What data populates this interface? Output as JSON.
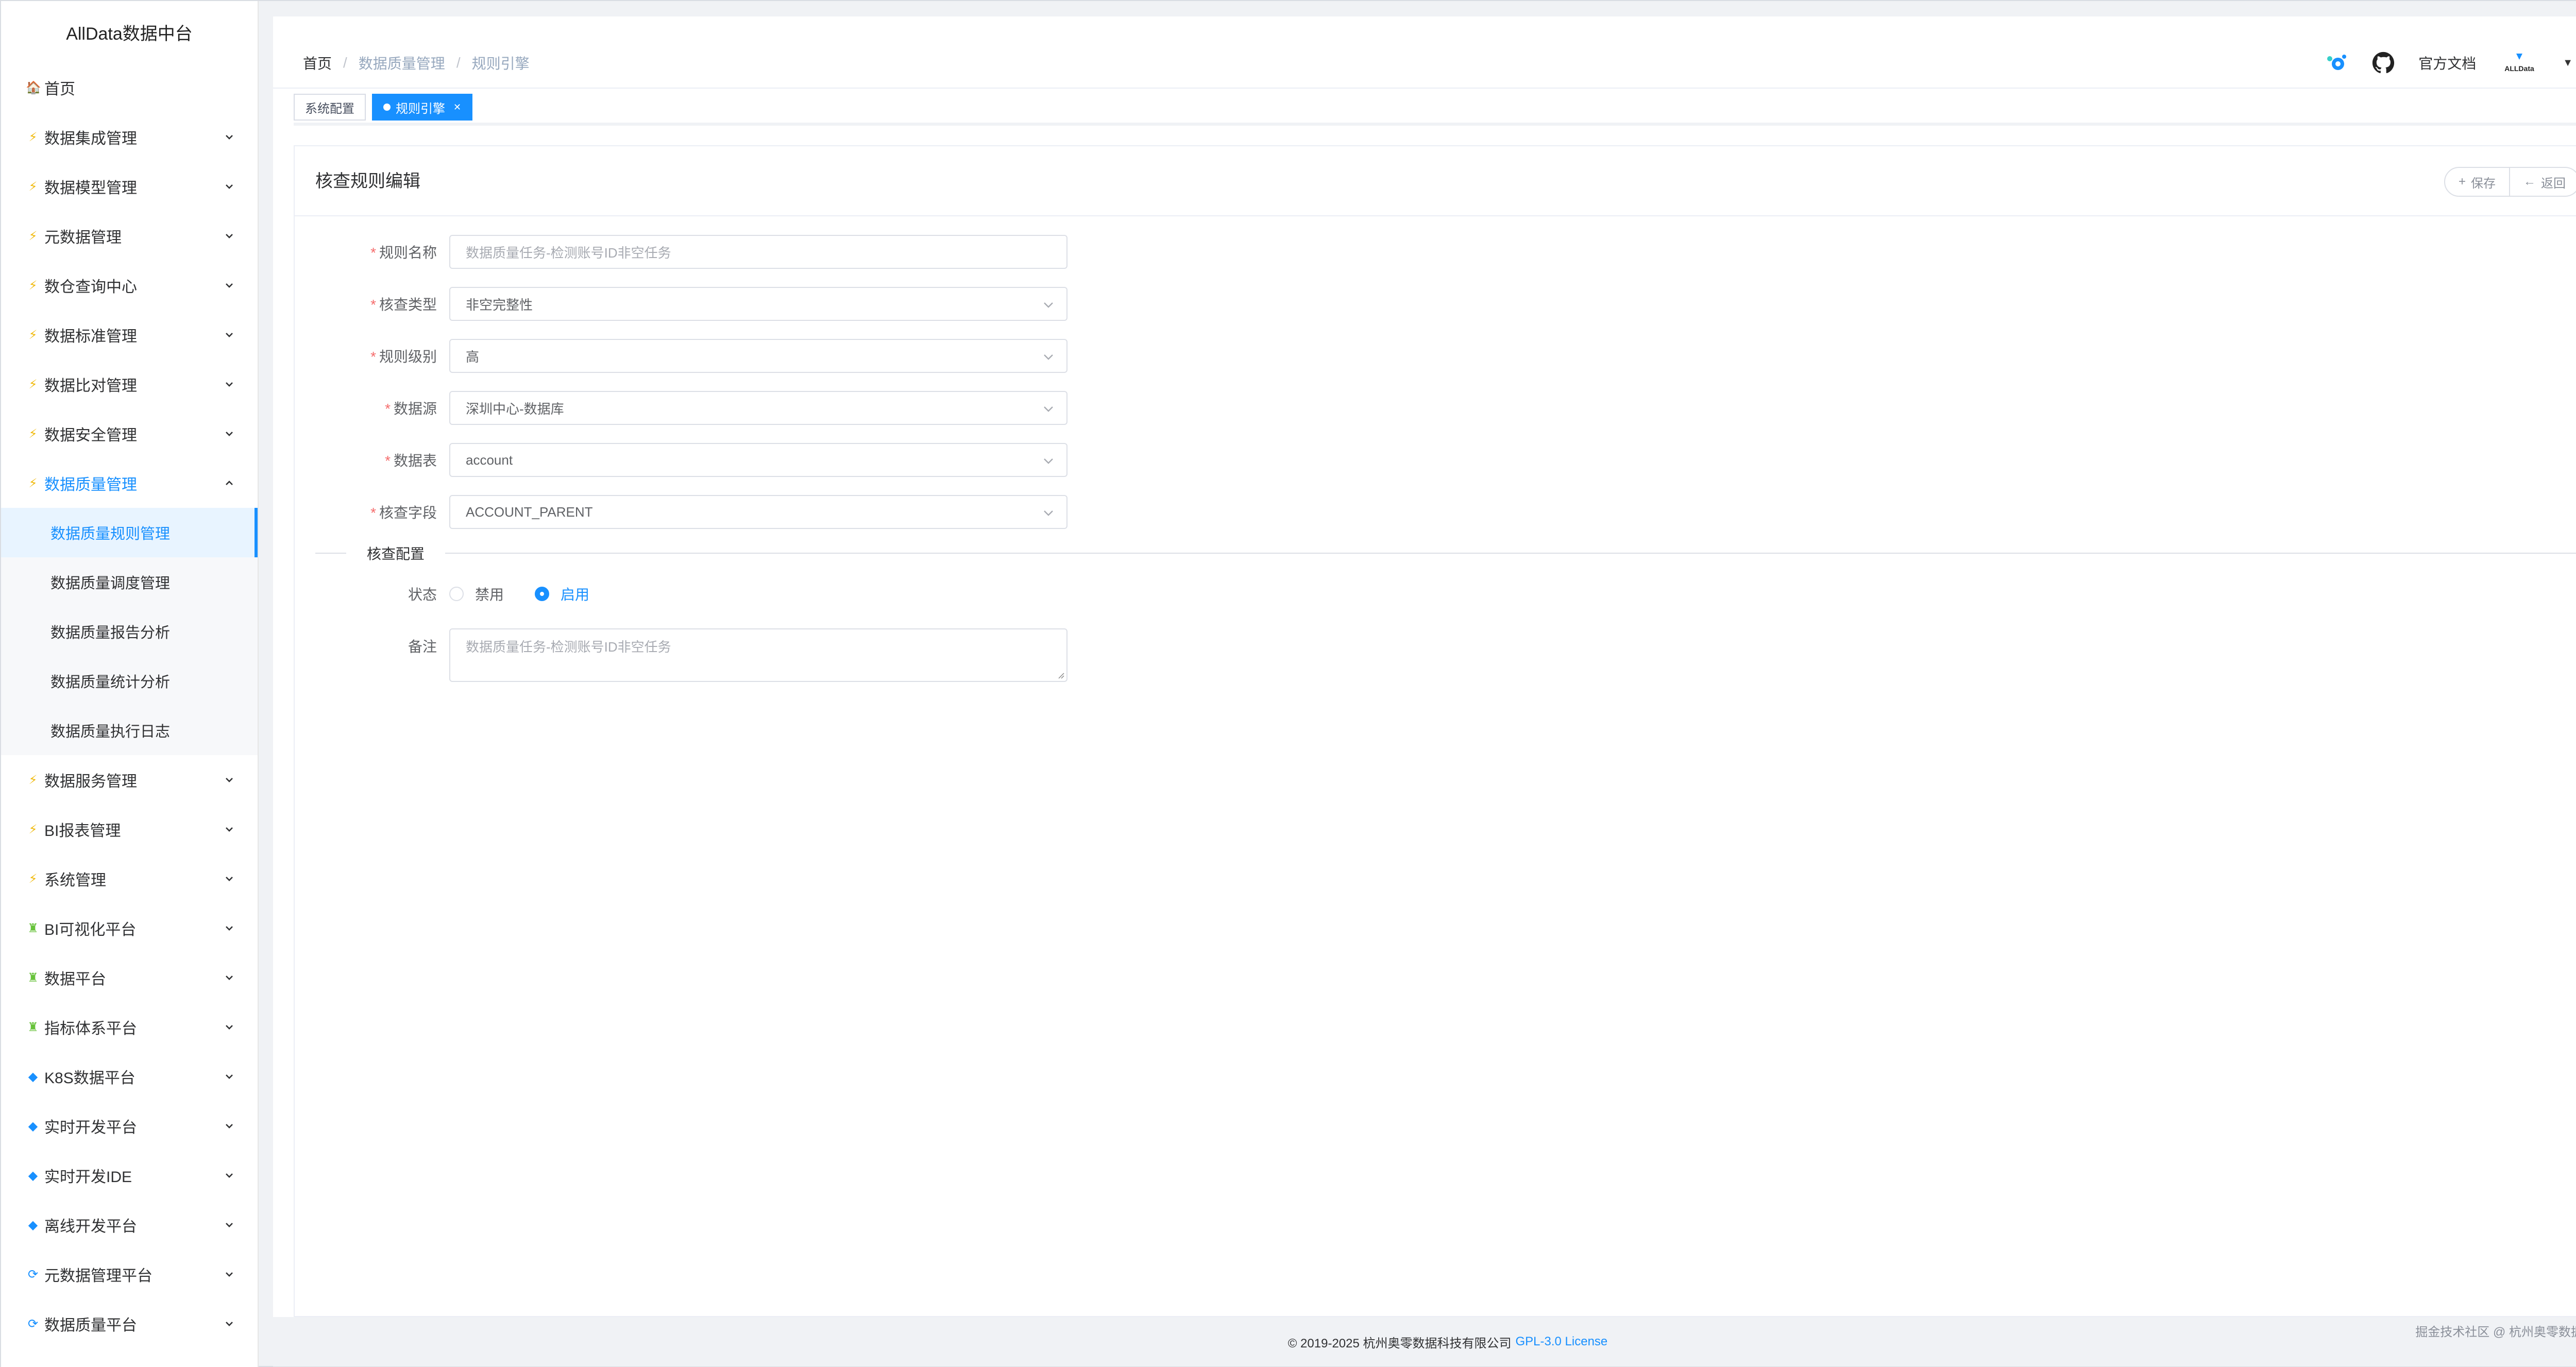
{
  "app": {
    "title": "AllData数据中台"
  },
  "sidebar": {
    "items": [
      {
        "icon": "home-icon",
        "label": "首页",
        "expandable": false
      },
      {
        "icon": "bolt-icon",
        "label": "数据集成管理",
        "expandable": true
      },
      {
        "icon": "bolt-icon",
        "label": "数据模型管理",
        "expandable": true
      },
      {
        "icon": "bolt-icon",
        "label": "元数据管理",
        "expandable": true
      },
      {
        "icon": "bolt-icon",
        "label": "数仓查询中心",
        "expandable": true
      },
      {
        "icon": "bolt-icon",
        "label": "数据标准管理",
        "expandable": true
      },
      {
        "icon": "bolt-icon",
        "label": "数据比对管理",
        "expandable": true
      },
      {
        "icon": "bolt-icon",
        "label": "数据安全管理",
        "expandable": true
      },
      {
        "icon": "bolt-icon",
        "label": "数据质量管理",
        "expandable": true,
        "expanded": true
      },
      {
        "icon": "bolt-icon",
        "label": "数据服务管理",
        "expandable": true
      },
      {
        "icon": "bolt-icon",
        "label": "BI报表管理",
        "expandable": true
      },
      {
        "icon": "bolt-icon",
        "label": "系统管理",
        "expandable": true
      },
      {
        "icon": "person-icon",
        "label": "BI可视化平台",
        "expandable": true
      },
      {
        "icon": "person-icon",
        "label": "数据平台",
        "expandable": true
      },
      {
        "icon": "person-icon",
        "label": "指标体系平台",
        "expandable": true
      },
      {
        "icon": "diamond-icon",
        "label": "K8S数据平台",
        "expandable": true
      },
      {
        "icon": "diamond-icon",
        "label": "实时开发平台",
        "expandable": true
      },
      {
        "icon": "diamond-icon",
        "label": "实时开发IDE",
        "expandable": true
      },
      {
        "icon": "diamond-icon",
        "label": "离线开发平台",
        "expandable": true
      },
      {
        "icon": "sync-icon",
        "label": "元数据管理平台",
        "expandable": true
      },
      {
        "icon": "sync-icon",
        "label": "数据质量平台",
        "expandable": true
      }
    ],
    "submenu": [
      {
        "label": "数据质量规则管理",
        "active": true
      },
      {
        "label": "数据质量调度管理"
      },
      {
        "label": "数据质量报告分析"
      },
      {
        "label": "数据质量统计分析"
      },
      {
        "label": "数据质量执行日志"
      }
    ]
  },
  "navbar": {
    "breadcrumb": [
      "首页",
      "数据质量管理",
      "规则引擎"
    ],
    "docs_label": "官方文档",
    "avatar_text": "ALLData"
  },
  "tags": [
    {
      "label": "系统配置",
      "active": false
    },
    {
      "label": "规则引擎",
      "active": true
    }
  ],
  "card": {
    "title": "核查规则编辑",
    "save_label": "保存",
    "back_label": "返回"
  },
  "form": {
    "rule_name": {
      "label": "规则名称",
      "placeholder": "数据质量任务-检测账号ID非空任务"
    },
    "check_type": {
      "label": "核查类型",
      "value": "非空完整性"
    },
    "rule_level": {
      "label": "规则级别",
      "value": "高"
    },
    "datasource": {
      "label": "数据源",
      "value": "深圳中心-数据库"
    },
    "table": {
      "label": "数据表",
      "value": "account"
    },
    "column": {
      "label": "核查字段",
      "value": "ACCOUNT_PARENT"
    },
    "section_title": "核查配置",
    "status": {
      "label": "状态",
      "options": [
        "禁用",
        "启用"
      ],
      "selected": "启用"
    },
    "remark": {
      "label": "备注",
      "placeholder": "数据质量任务-检测账号ID非空任务"
    }
  },
  "footer": {
    "copyright": "© 2019-2025 杭州奥零数据科技有限公司",
    "license": "GPL-3.0 License",
    "watermark": "掘金技术社区 @ 杭州奥零数据科技"
  },
  "colors": {
    "accent": "#1890ff",
    "required": "#f56c6c"
  }
}
